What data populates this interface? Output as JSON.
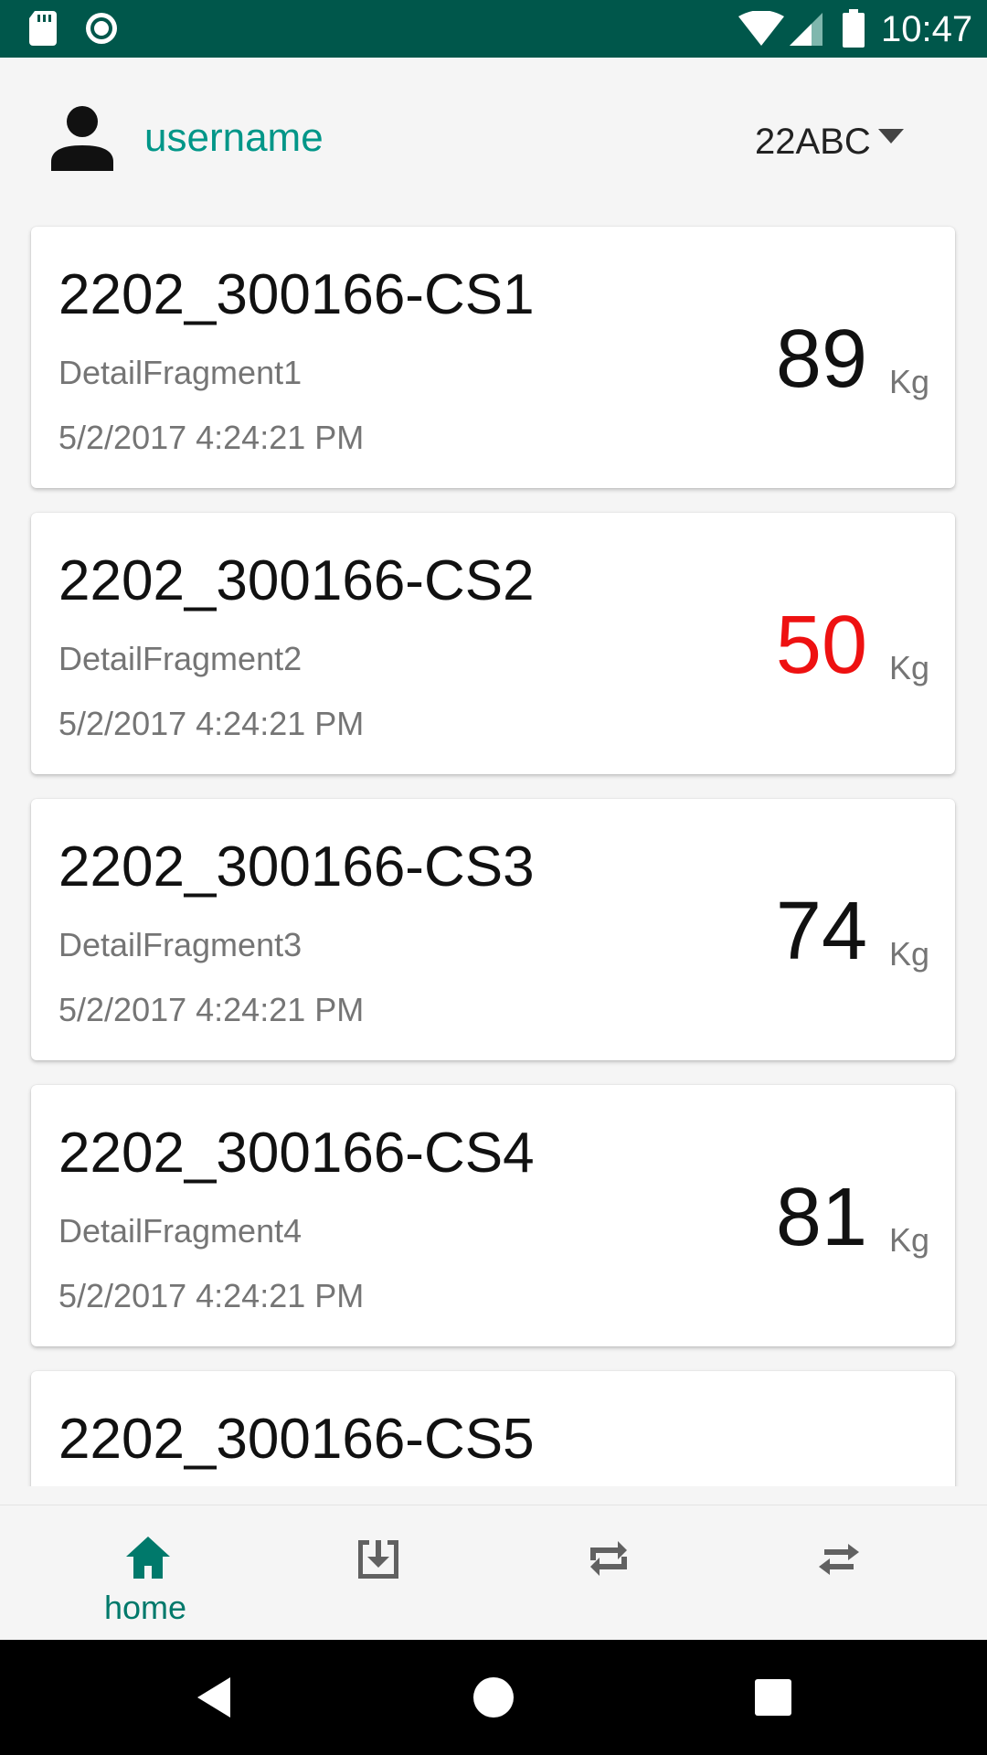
{
  "status_bar": {
    "time": "10:47",
    "icons": [
      "sd-card-icon",
      "record-icon",
      "wifi-icon",
      "signal-icon",
      "battery-icon"
    ]
  },
  "header": {
    "username": "username",
    "selected_unit": "22ABC"
  },
  "items": [
    {
      "title": "2202_300166-CS1",
      "subtitle": "DetailFragment1",
      "date": "5/2/2017 4:24:21 PM",
      "weight": "89",
      "unit": "Kg",
      "alert": false
    },
    {
      "title": "2202_300166-CS2",
      "subtitle": "DetailFragment2",
      "date": "5/2/2017 4:24:21 PM",
      "weight": "50",
      "unit": "Kg",
      "alert": true
    },
    {
      "title": "2202_300166-CS3",
      "subtitle": "DetailFragment3",
      "date": "5/2/2017 4:24:21 PM",
      "weight": "74",
      "unit": "Kg",
      "alert": false
    },
    {
      "title": "2202_300166-CS4",
      "subtitle": "DetailFragment4",
      "date": "5/2/2017 4:24:21 PM",
      "weight": "81",
      "unit": "Kg",
      "alert": false
    },
    {
      "title": "2202_300166-CS5",
      "subtitle": "",
      "date": "",
      "weight": "",
      "unit": "",
      "alert": true
    }
  ],
  "bottom_nav": {
    "items": [
      {
        "icon": "home-icon",
        "label": "home",
        "active": true
      },
      {
        "icon": "download-icon",
        "label": "",
        "active": false
      },
      {
        "icon": "repeat-icon",
        "label": "",
        "active": false
      },
      {
        "icon": "swap-icon",
        "label": "",
        "active": false
      }
    ]
  },
  "colors": {
    "status_bar": "#00574B",
    "accent": "#009688",
    "nav_active": "#00796B",
    "alert": "#EE1111"
  }
}
